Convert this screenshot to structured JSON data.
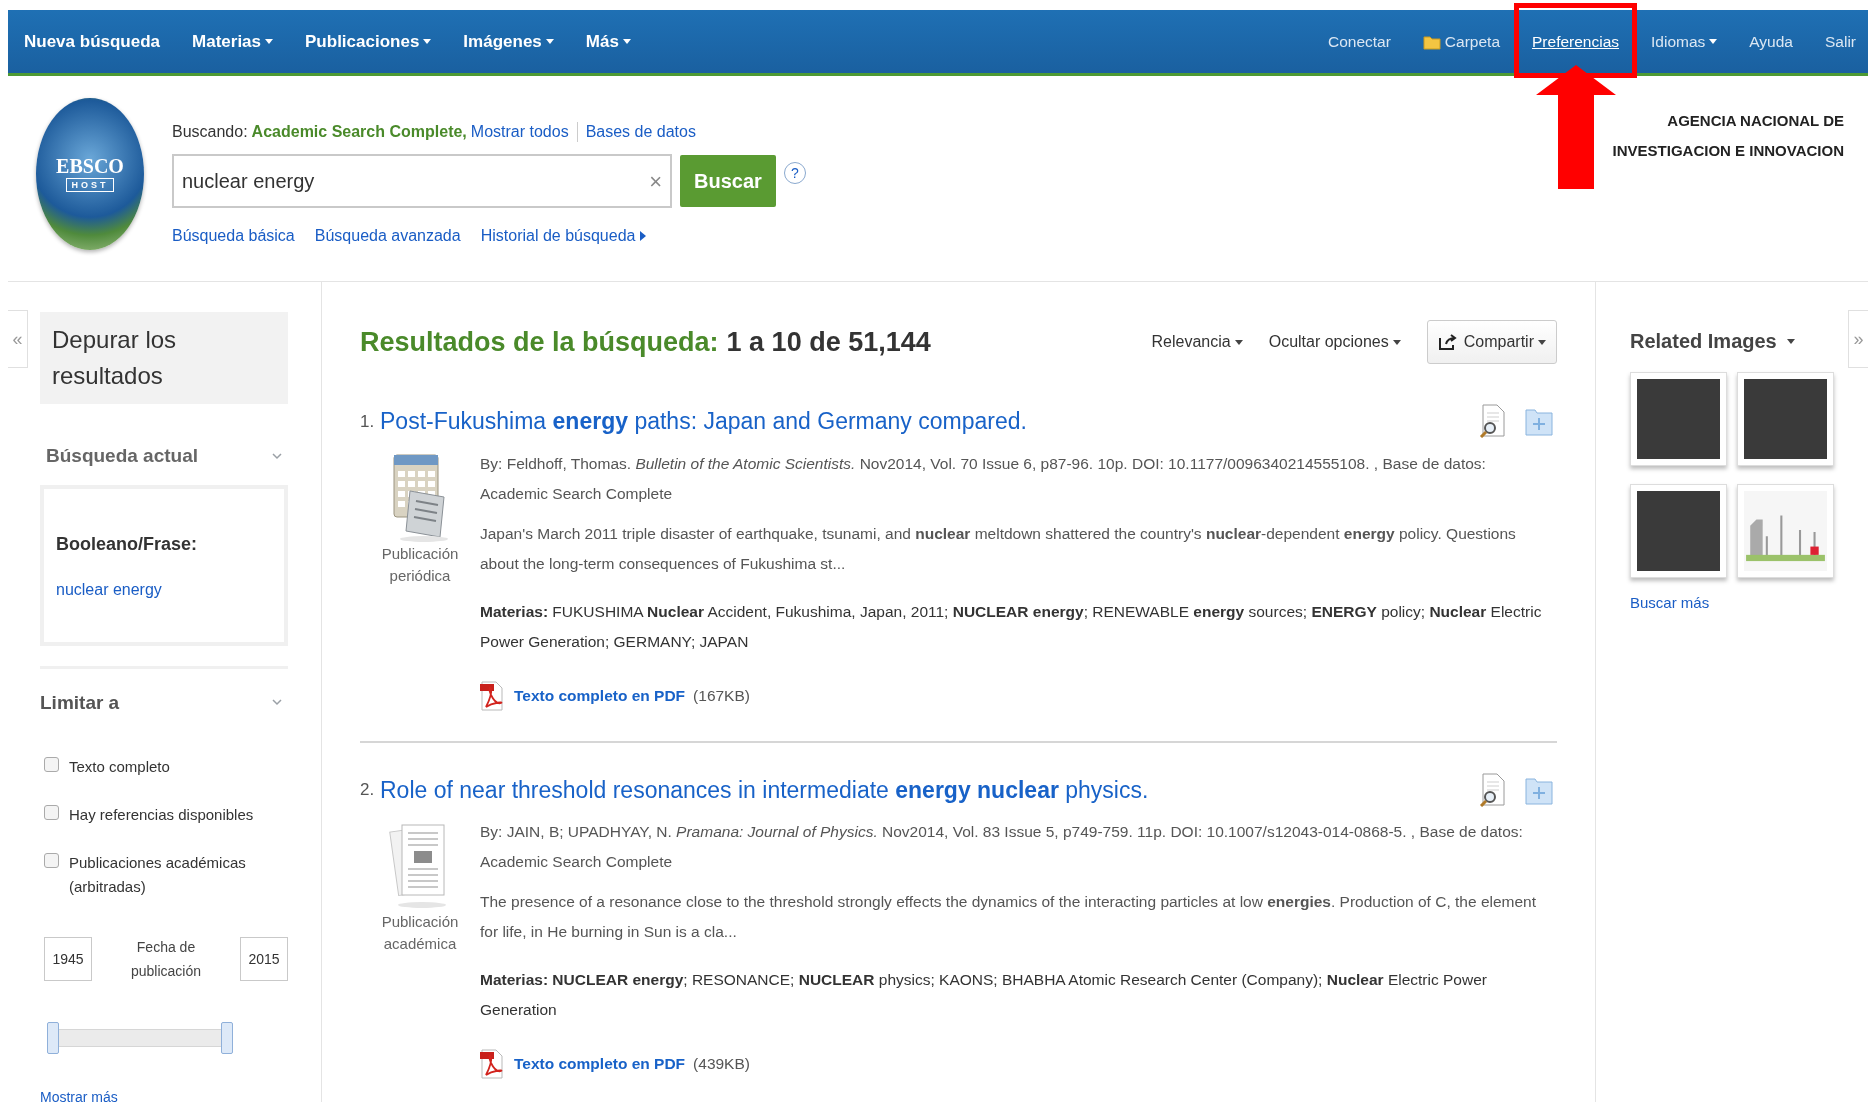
{
  "nav": {
    "left": [
      {
        "label": "Nueva búsqueda",
        "has_caret": false
      },
      {
        "label": "Materias",
        "has_caret": true
      },
      {
        "label": "Publicaciones",
        "has_caret": true
      },
      {
        "label": "Imágenes",
        "has_caret": true
      },
      {
        "label": "Más",
        "has_caret": true
      }
    ],
    "right": [
      {
        "label": "Conectar",
        "kind": "plain",
        "has_caret": false,
        "selected": false
      },
      {
        "label": "Carpeta",
        "kind": "folder",
        "has_caret": false,
        "selected": false
      },
      {
        "label": "Preferencias",
        "kind": "plain",
        "has_caret": false,
        "selected": true
      },
      {
        "label": "Idiomas",
        "kind": "plain",
        "has_caret": true,
        "selected": false
      },
      {
        "label": "Ayuda",
        "kind": "plain",
        "has_caret": false,
        "selected": false
      },
      {
        "label": "Salir",
        "kind": "plain",
        "has_caret": false,
        "selected": false
      }
    ]
  },
  "logo": {
    "top": "EBSCO",
    "bottom": "HOST"
  },
  "search": {
    "searching_label": "Buscando:",
    "database": "Academic Search Complete,",
    "show_all": "Mostrar todos",
    "databases_link": "Bases de datos",
    "value": "nuclear energy",
    "clear": "×",
    "button": "Buscar",
    "help": "?",
    "links": [
      {
        "label": "Búsqueda básica",
        "has_arrow": false
      },
      {
        "label": "Búsqueda avanzada",
        "has_arrow": false
      },
      {
        "label": "Historial de búsqueda",
        "has_arrow": true
      }
    ]
  },
  "organization": [
    "AGENCIA NACIONAL DE",
    "INVESTIGACION E INNOVACION"
  ],
  "sidebar": {
    "collapse": "«",
    "title": "Depurar los resultados",
    "current_search": {
      "heading": "Búsqueda actual",
      "expanded": true,
      "label": "Booleano/Frase:",
      "query": "nuclear energy"
    },
    "limit": {
      "heading": "Limitar a",
      "expanded": true,
      "checkboxes": [
        {
          "label": "Texto completo",
          "checked": false
        },
        {
          "label": "Hay referencias disponibles",
          "checked": false
        },
        {
          "label": "Publicaciones académicas (arbitradas)",
          "checked": false
        }
      ],
      "date_from": "1945",
      "date_label": "Fecha de publicación",
      "date_to": "2015",
      "range": {
        "level": 1
      },
      "show_more": "Mostrar más"
    }
  },
  "results": {
    "heading": "Resultados de la búsqueda:",
    "count": "1 a 10 de 51,144",
    "sort": "Relevancia",
    "options": "Ocultar opciones",
    "share": "Compartir",
    "items": [
      {
        "number": "1.",
        "title": "Post-Fukushima **energy** paths: Japan and Germany compared.",
        "kind": "periodical",
        "type_label": "Publicación periódica",
        "meta": "By: Feldhoff, Thomas. *Bulletin of the Atomic Scientists.* Nov2014, Vol. 70 Issue 6, p87-96. 10p. DOI: 10.1177/0096340214555108. , Base de datos: Academic Search Complete",
        "abstract": "Japan's March 2011 triple disaster of earthquake, tsunami, and **nuclear** meltdown shattered the country's **nuclear**-dependent **energy** policy. Questions about the long-term consequences of Fukushima st...",
        "subjects": "**Materias:** FUKUSHIMA **Nuclear** Accident, Fukushima, Japan, 2011; **NUCLEAR energy**; RENEWABLE **energy** sources; **ENERGY** policy; **Nuclear** Electric Power Generation; GERMANY; JAPAN",
        "pdf_link": "Texto completo en PDF",
        "pdf_size": "(167KB)"
      },
      {
        "number": "2.",
        "title": "Role of near threshold resonances in intermediate **energy nuclear** physics.",
        "kind": "academic",
        "type_label": "Publicación académica",
        "meta": "By: JAIN, B; UPADHYAY, N. *Pramana: Journal of Physics.* Nov2014, Vol. 83 Issue 5, p749-759. 11p. DOI: 10.1007/s12043-014-0868-5. , Base de datos: Academic Search Complete",
        "abstract": "The presence of a resonance close to the threshold strongly effects the dynamics of the interacting particles at low **energies**. Production of C, the element for life, in He burning in Sun is a cla...",
        "subjects": "**Materias: NUCLEAR energy**; RESONANCE; **NUCLEAR** physics; KAONS; BHABHA Atomic Research Center (Company); **Nuclear** Electric Power Generation",
        "pdf_link": "Texto completo en PDF",
        "pdf_size": "(439KB)"
      }
    ]
  },
  "related": {
    "heading": "Related Images",
    "images": [
      {
        "kind": "photo"
      },
      {
        "kind": "photo"
      },
      {
        "kind": "photo"
      },
      {
        "kind": "diagram"
      }
    ],
    "more": "Buscar más",
    "expand": "»"
  }
}
